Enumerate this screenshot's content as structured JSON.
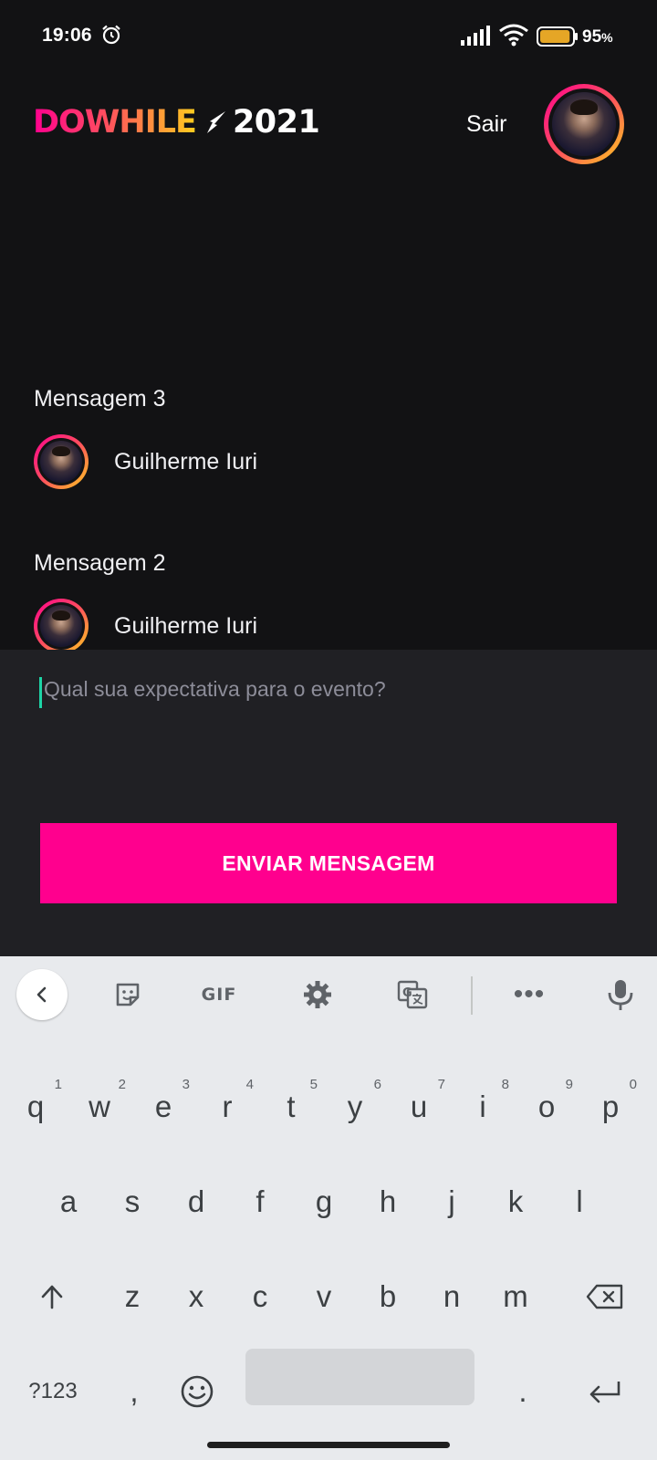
{
  "status_bar": {
    "time": "19:06",
    "battery_percent": "95",
    "battery_unit": "%",
    "battery_level": 0.95
  },
  "header": {
    "logo_word": "DOWHILE",
    "logo_year": "2021",
    "logout_label": "Sair"
  },
  "colors": {
    "accent": "#ff008e",
    "gradient_start": "#ff008e",
    "gradient_mid": "#ff4f5e",
    "gradient_end": "#ffcd1e",
    "background": "#121214",
    "composer_bg": "#202024",
    "cursor": "#1dd4a6"
  },
  "messages": [
    {
      "text": "Mensagem 3",
      "author": "Guilherme Iuri"
    },
    {
      "text": "Mensagem 2",
      "author": "Guilherme Iuri"
    }
  ],
  "composer": {
    "placeholder": "Qual sua expectativa para o evento?",
    "send_label": "ENVIAR MENSAGEM"
  },
  "keyboard": {
    "toolbar_icons": [
      "chevron-left-icon",
      "sticker-icon",
      "gif-icon",
      "gear-icon",
      "translate-icon",
      "more-icon",
      "mic-icon"
    ],
    "gif_label": "GIF",
    "more_label": "•••",
    "row1": [
      {
        "key": "q",
        "hint": "1"
      },
      {
        "key": "w",
        "hint": "2"
      },
      {
        "key": "e",
        "hint": "3"
      },
      {
        "key": "r",
        "hint": "4"
      },
      {
        "key": "t",
        "hint": "5"
      },
      {
        "key": "y",
        "hint": "6"
      },
      {
        "key": "u",
        "hint": "7"
      },
      {
        "key": "i",
        "hint": "8"
      },
      {
        "key": "o",
        "hint": "9"
      },
      {
        "key": "p",
        "hint": "0"
      }
    ],
    "row2": [
      "a",
      "s",
      "d",
      "f",
      "g",
      "h",
      "j",
      "k",
      "l"
    ],
    "row3": [
      "z",
      "x",
      "c",
      "v",
      "b",
      "n",
      "m"
    ],
    "symbols_label": "?123",
    "comma_label": ",",
    "period_label": "."
  }
}
